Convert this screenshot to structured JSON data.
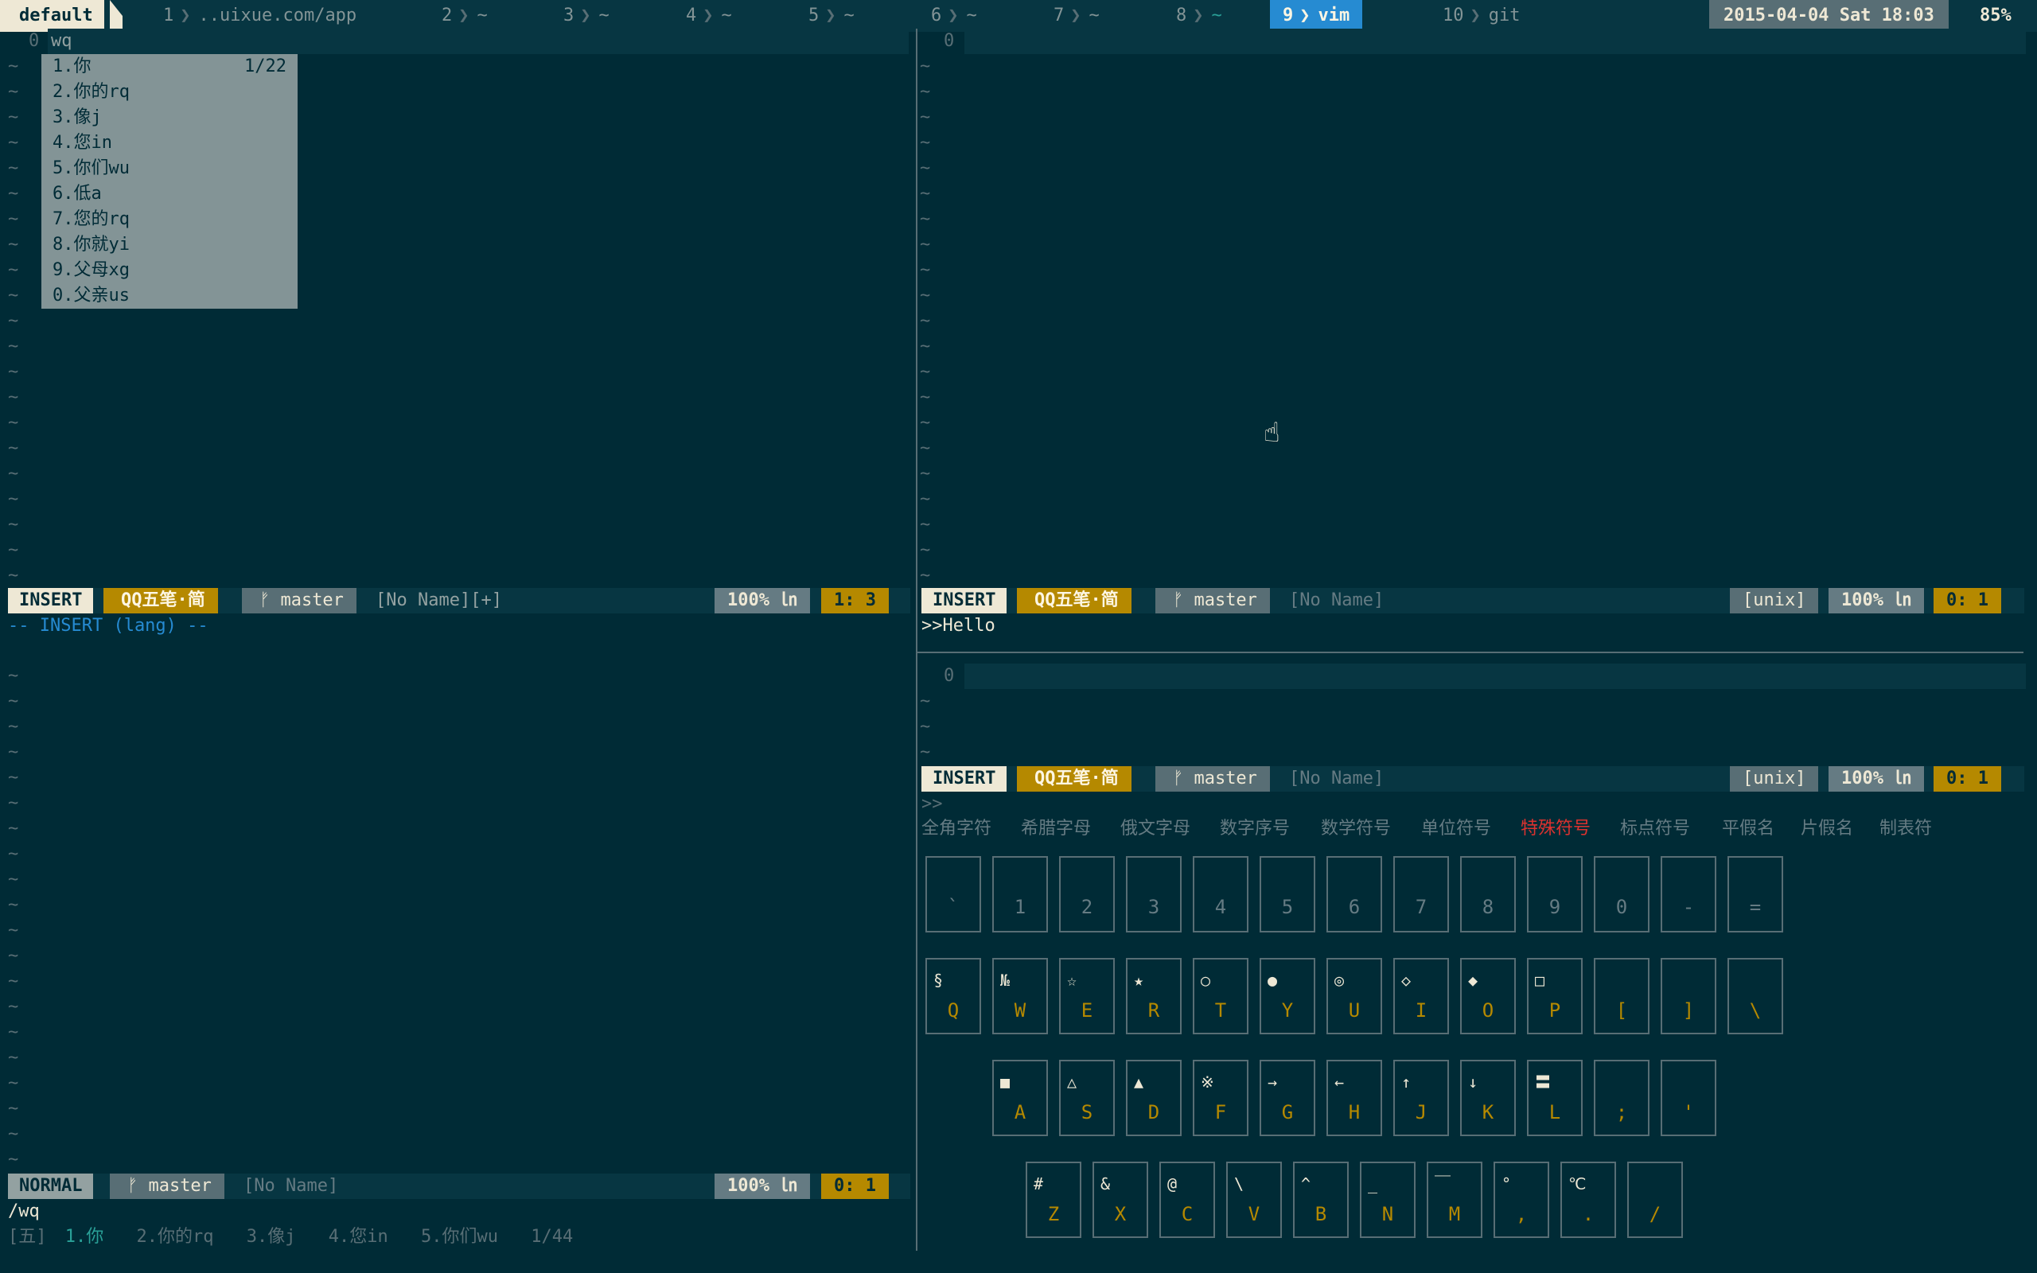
{
  "tmux": {
    "session": "default",
    "windows": [
      {
        "num": "1",
        "name": "..uixue.com/app"
      },
      {
        "num": "2",
        "name": "~"
      },
      {
        "num": "3",
        "name": "~"
      },
      {
        "num": "4",
        "name": "~"
      },
      {
        "num": "5",
        "name": "~"
      },
      {
        "num": "6",
        "name": "~"
      },
      {
        "num": "7",
        "name": "~"
      },
      {
        "num": "8",
        "name": "~"
      },
      {
        "num": "9",
        "name": "vim"
      },
      {
        "num": "10",
        "name": "git"
      }
    ],
    "datetime": "2015-04-04 Sat 18:03",
    "battery": "85%"
  },
  "pane_tl": {
    "line_number": "0",
    "line_text": "wq",
    "popup": {
      "counter": "1/22",
      "items": [
        "1.你",
        "2.你的rq",
        "3.像j",
        "4.您in",
        "5.你们wu",
        "6.低a",
        "7.您的rq",
        "8.你就yi",
        "9.父母xg",
        "0.父亲us"
      ]
    },
    "status": {
      "mode": "INSERT",
      "ime": "QQ五笔·简",
      "branch": "master",
      "file": "[No Name][+]",
      "percent": "100%",
      "ln_icon": "㏑",
      "pos": "1:  3"
    },
    "cmdline": "-- INSERT (lang) --"
  },
  "pane_tr": {
    "line_number": "0",
    "status": {
      "mode": "INSERT",
      "ime": "QQ五笔·简",
      "branch": "master",
      "file": "[No Name]",
      "fileformat": "[unix]",
      "percent": "100%",
      "ln_icon": "㏑",
      "pos": "0:  1"
    },
    "cmdline": ">>Hello"
  },
  "pane_bl": {
    "status": {
      "mode": "NORMAL",
      "branch": "master",
      "file": "[No Name]",
      "percent": "100%",
      "ln_icon": "㏑",
      "pos": "0:  1"
    },
    "search": "/wq",
    "candidates": {
      "ime_tag": "[五]",
      "items": [
        "1.你",
        "2.你的rq",
        "3.像j",
        "4.您in",
        "5.你们wu"
      ],
      "count": "1/44"
    }
  },
  "pane_br": {
    "line_number": "0",
    "status": {
      "mode": "INSERT",
      "ime": "QQ五笔·简",
      "branch": "master",
      "file": "[No Name]",
      "fileformat": "[unix]",
      "percent": "100%",
      "ln_icon": "㏑",
      "pos": "0:  1"
    },
    "cmdline": ">>",
    "categories": [
      "全角字符",
      "希腊字母",
      "俄文字母",
      "数字序号",
      "数学符号",
      "单位符号",
      "特殊符号",
      "标点符号",
      "平假名",
      "片假名",
      "制表符"
    ],
    "active_category": "特殊符号",
    "keyboard": {
      "row1": [
        {
          "sym": "",
          "key": "`"
        },
        {
          "sym": "",
          "key": "1"
        },
        {
          "sym": "",
          "key": "2"
        },
        {
          "sym": "",
          "key": "3"
        },
        {
          "sym": "",
          "key": "4"
        },
        {
          "sym": "",
          "key": "5"
        },
        {
          "sym": "",
          "key": "6"
        },
        {
          "sym": "",
          "key": "7"
        },
        {
          "sym": "",
          "key": "8"
        },
        {
          "sym": "",
          "key": "9"
        },
        {
          "sym": "",
          "key": "0"
        },
        {
          "sym": "",
          "key": "-"
        },
        {
          "sym": "",
          "key": "="
        }
      ],
      "row2": [
        {
          "sym": "§",
          "key": "Q"
        },
        {
          "sym": "№",
          "key": "W"
        },
        {
          "sym": "☆",
          "key": "E"
        },
        {
          "sym": "★",
          "key": "R"
        },
        {
          "sym": "○",
          "key": "T"
        },
        {
          "sym": "●",
          "key": "Y"
        },
        {
          "sym": "◎",
          "key": "U"
        },
        {
          "sym": "◇",
          "key": "I"
        },
        {
          "sym": "◆",
          "key": "O"
        },
        {
          "sym": "□",
          "key": "P"
        },
        {
          "sym": "",
          "key": "["
        },
        {
          "sym": "",
          "key": "]"
        },
        {
          "sym": "",
          "key": "\\"
        }
      ],
      "row3": [
        {
          "sym": "■",
          "key": "A"
        },
        {
          "sym": "△",
          "key": "S"
        },
        {
          "sym": "▲",
          "key": "D"
        },
        {
          "sym": "※",
          "key": "F"
        },
        {
          "sym": "→",
          "key": "G"
        },
        {
          "sym": "←",
          "key": "H"
        },
        {
          "sym": "↑",
          "key": "J"
        },
        {
          "sym": "↓",
          "key": "K"
        },
        {
          "sym": "〓",
          "key": "L"
        },
        {
          "sym": "",
          "key": ";"
        },
        {
          "sym": "",
          "key": "'"
        }
      ],
      "row4": [
        {
          "sym": "#",
          "key": "Z"
        },
        {
          "sym": "&",
          "key": "X"
        },
        {
          "sym": "@",
          "key": "C"
        },
        {
          "sym": "\\",
          "key": "V"
        },
        {
          "sym": "^",
          "key": "B"
        },
        {
          "sym": "_",
          "key": "N"
        },
        {
          "sym": "￣",
          "key": "M"
        },
        {
          "sym": "°",
          "key": ","
        },
        {
          "sym": "℃",
          "key": "."
        },
        {
          "sym": "",
          "key": "/"
        }
      ]
    }
  },
  "colors": {
    "base03": "#002b36",
    "base02": "#073642",
    "yellow": "#b58900",
    "blue": "#268bd2",
    "red": "#dc322f",
    "cyan": "#2aa198"
  }
}
